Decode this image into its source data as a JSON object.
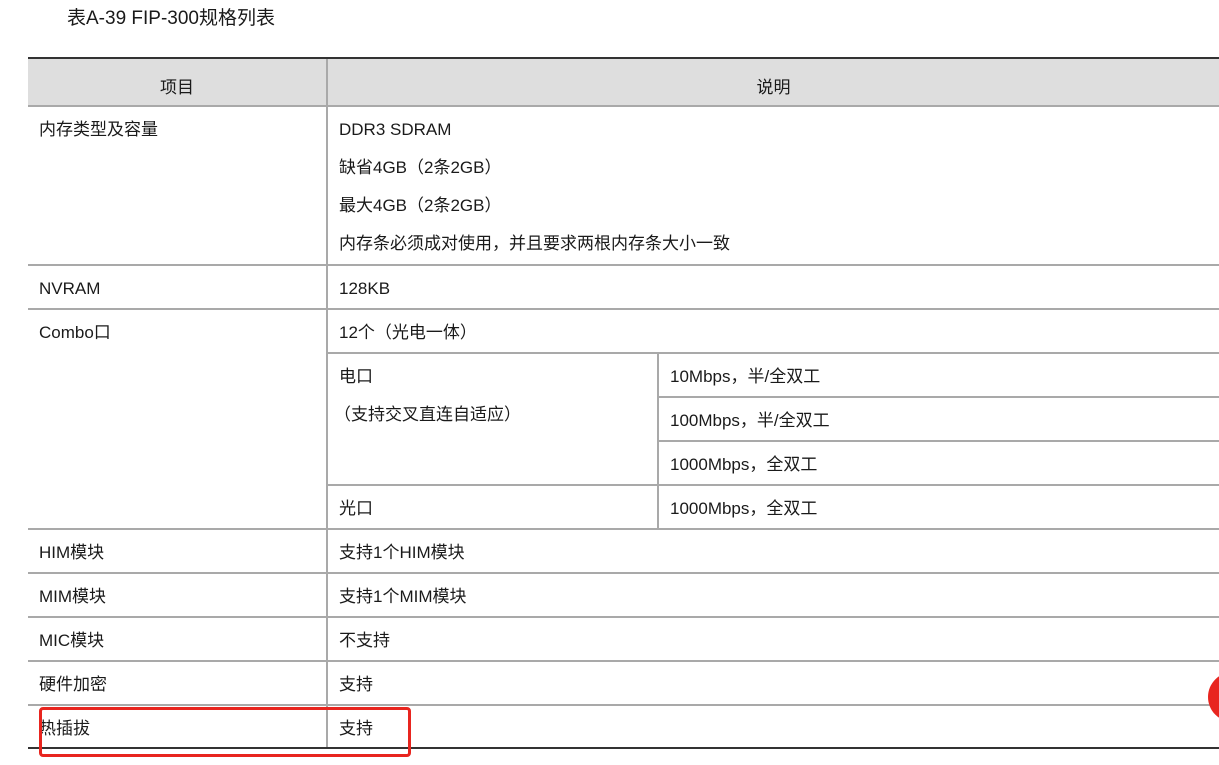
{
  "caption": "表A-39 FIP-300规格列表",
  "header": {
    "item": "项目",
    "desc": "说明"
  },
  "rows": [
    {
      "item": "内存类型及容量",
      "lines": [
        "DDR3 SDRAM",
        "缺省4GB（2条2GB）",
        "最大4GB（2条2GB）",
        "内存条必须成对使用，并且要求两根内存条大小一致"
      ]
    },
    {
      "item": "NVRAM",
      "value": "128KB"
    },
    {
      "item": "Combo口",
      "value": "12个（光电一体）",
      "sub": [
        {
          "label": "电口",
          "note": "（支持交叉直连自适应）",
          "values": [
            "10Mbps，半/全双工",
            "100Mbps，半/全双工",
            "1000Mbps，全双工"
          ]
        },
        {
          "label": "光口",
          "values": [
            "1000Mbps，全双工"
          ]
        }
      ]
    },
    {
      "item": "HIM模块",
      "value": "支持1个HIM模块"
    },
    {
      "item": "MIM模块",
      "value": "支持1个MIM模块"
    },
    {
      "item": "MIC模块",
      "value": "不支持"
    },
    {
      "item": "硬件加密",
      "value": "支持"
    },
    {
      "item": "热插拔",
      "value": "支持"
    }
  ],
  "highlight_color": "#e8251f"
}
